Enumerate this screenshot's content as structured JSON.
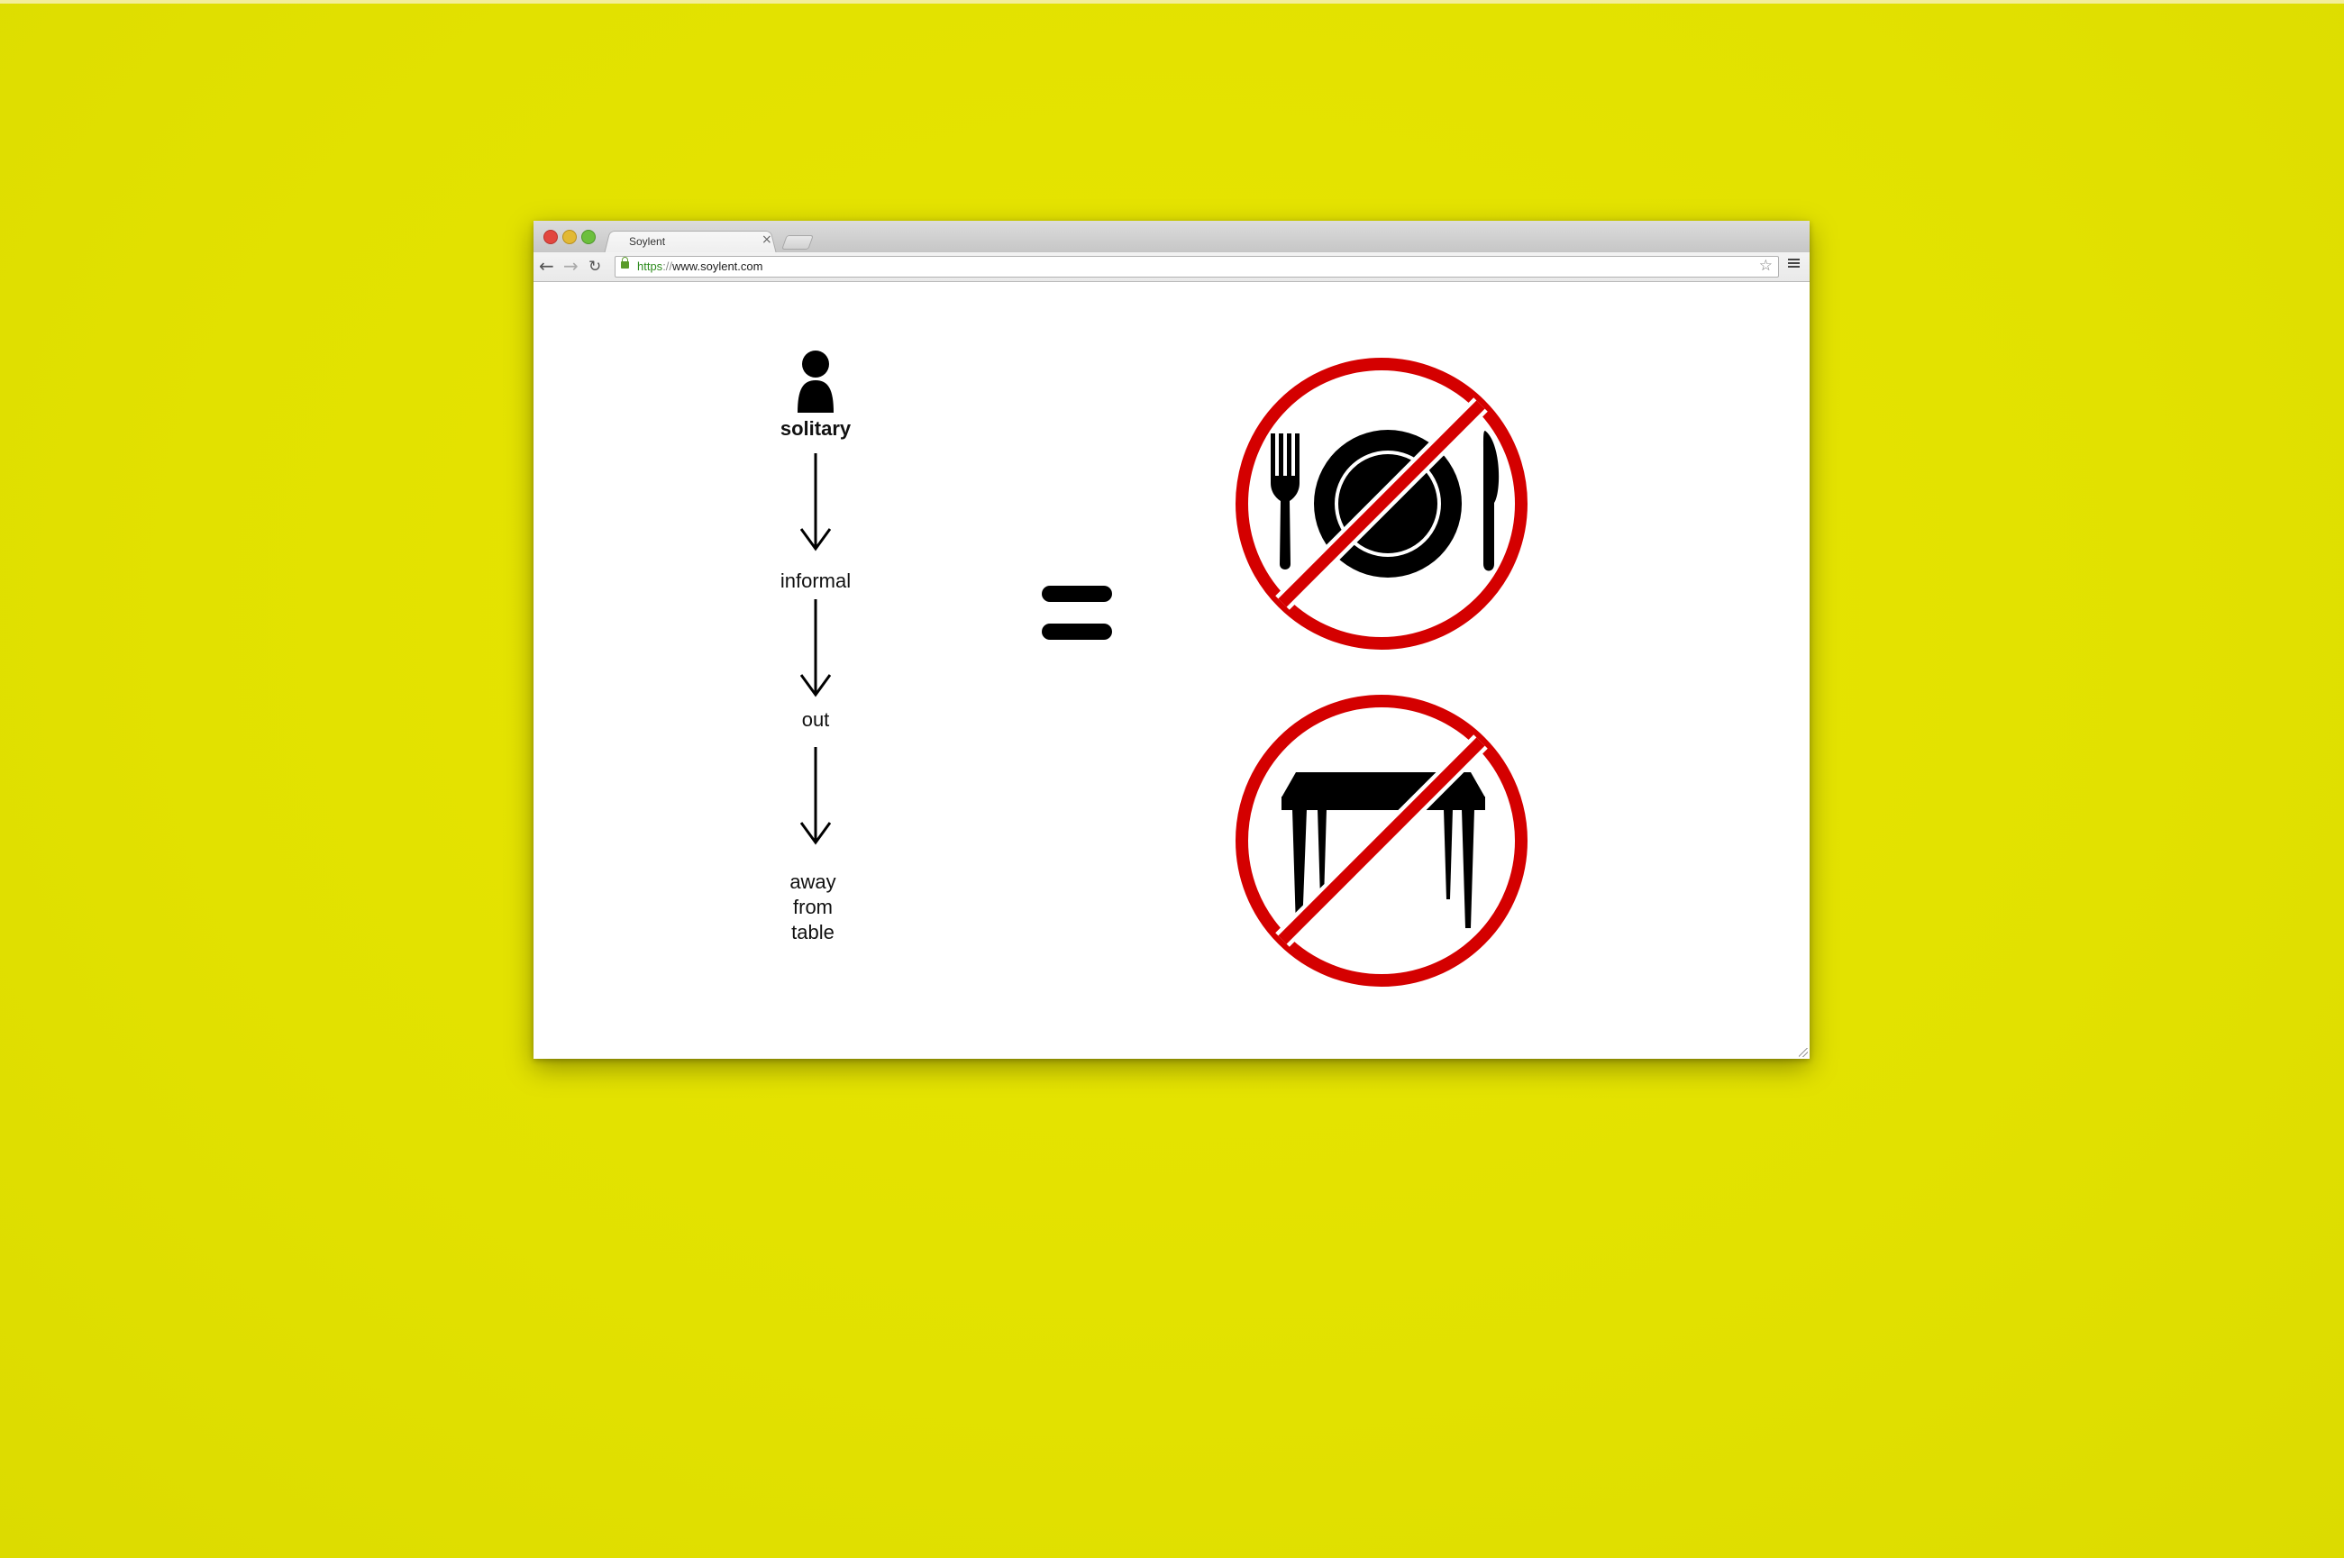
{
  "browser": {
    "tab_title": "Soylent",
    "tab_close": "×",
    "url_scheme": "https",
    "url_separator": "://",
    "url_host": "www.soylent.com"
  },
  "page": {
    "flow": [
      {
        "label": "solitary"
      },
      {
        "label": "informal"
      },
      {
        "label": "out"
      },
      {
        "label": "away\nfrom\ntable"
      }
    ],
    "icons": [
      "person-icon",
      "arrow-down-icon",
      "equals-icon",
      "no-dining-icon",
      "no-table-icon"
    ],
    "colors": {
      "background": "#e4e300",
      "prohibition_red": "#d40000",
      "ink": "#000000"
    }
  }
}
